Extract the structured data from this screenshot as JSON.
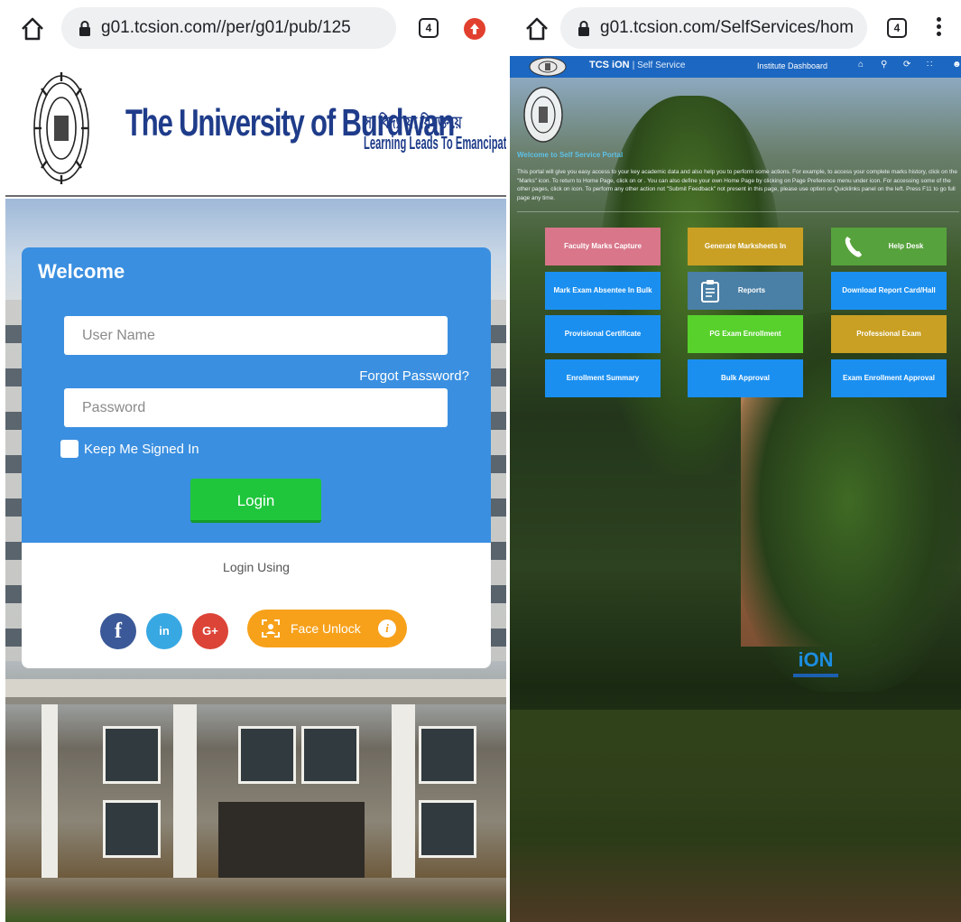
{
  "left_browser": {
    "url": "g01.tcsion.com//per/g01/pub/125",
    "tab_count": "4"
  },
  "burdwan": {
    "university_name": "The University of Burdwan",
    "motto_bengali": "সা বিদ্যা যা বিমুক্তয়ে",
    "motto_english": "Learning Leads To Emancipation"
  },
  "login": {
    "welcome": "Welcome",
    "username_placeholder": "User Name",
    "forgot_password": "Forgot Password?",
    "password_placeholder": "Password",
    "keep_signed_in": "Keep Me Signed In",
    "login_button": "Login",
    "login_using": "Login Using",
    "face_unlock": "Face Unlock",
    "info_glyph": "i",
    "social": [
      {
        "name": "facebook",
        "glyph": "f",
        "color": "#3b5998"
      },
      {
        "name": "linkedin",
        "glyph": "in",
        "color": "#38a8e3"
      },
      {
        "name": "google-plus",
        "glyph": "G+",
        "color": "#dc4437"
      }
    ],
    "colors": {
      "primary": "#3a8fe0",
      "login_button": "#1fc63c",
      "face_unlock": "#f7a11b"
    }
  },
  "right_browser": {
    "url": "g01.tcsion.com/SelfServices/hom",
    "tab_count": "4"
  },
  "tcs": {
    "brand": "TCS iON",
    "brand_suffix": "| Self Service",
    "dashboard": "Institute Dashboard",
    "nav_icons": [
      "home-icon",
      "search-icon",
      "refresh-icon",
      "grid-icon",
      "user-icon"
    ],
    "welcome_title": "Welcome to Self Service Portal",
    "welcome_text": "This portal will give you easy access to your key academic data and also help you to perform some actions. For example, to access your complete marks history, click on the \"Marks\" icon. To return to Home Page, click on or . You can also define your own Home Page by clicking on Page Preference menu under icon. For accessing some of the other pages, click on icon. To perform any other action not \"Submit Feedback\" not present in this page, please use option or Quicklinks panel on the left. Press F11 to go full page any time.",
    "tiles": [
      {
        "label": "Faculty Marks Capture",
        "color": "#d9768a"
      },
      {
        "label": "Generate Marksheets In",
        "color": "#c9a024"
      },
      {
        "label": "Help Desk",
        "color": "#56a23c",
        "icon": "phone-icon"
      },
      {
        "label": "Mark Exam Absentee In Bulk",
        "color": "#1a8ff0"
      },
      {
        "label": "Reports",
        "color": "#4a7fa6",
        "icon": "clipboard-icon"
      },
      {
        "label": "Download Report Card/Hall",
        "color": "#1a8ff0"
      },
      {
        "label": "Provisional Certificate",
        "color": "#1a8ff0"
      },
      {
        "label": "PG Exam Enrollment",
        "color": "#58d12d"
      },
      {
        "label": "Professional Exam",
        "color": "#c9a024"
      },
      {
        "label": "Enrollment Summary",
        "color": "#1a8ff0"
      },
      {
        "label": "Bulk Approval",
        "color": "#1a8ff0"
      },
      {
        "label": "Exam Enrollment Approval",
        "color": "#1a8ff0"
      }
    ],
    "footer_logo": "iON",
    "colors": {
      "topbar": "#1c67c1",
      "welcome_title": "#5ec1e6"
    }
  }
}
